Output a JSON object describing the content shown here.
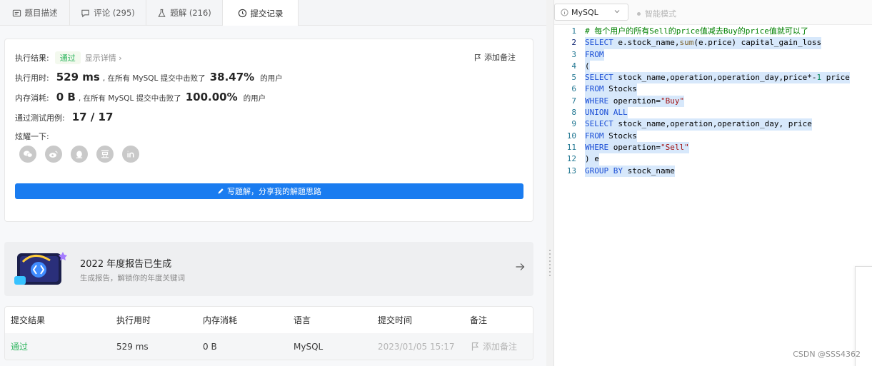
{
  "tabs": [
    {
      "label": "题目描述",
      "icon": "description-icon"
    },
    {
      "label": "评论 (295)",
      "icon": "comment-icon"
    },
    {
      "label": "题解 (216)",
      "icon": "flask-icon"
    },
    {
      "label": "提交记录",
      "icon": "clock-icon"
    }
  ],
  "result": {
    "label": "执行结果:",
    "status": "通过",
    "detail_link": "显示详情 ›",
    "add_note": "添加备注",
    "runtime_label": "执行用时:",
    "runtime_value": "529 ms",
    "runtime_text": ", 在所有 MySQL 提交中击败了",
    "runtime_percent": "38.47%",
    "runtime_suffix": "的用户",
    "memory_label": "内存消耗:",
    "memory_value": "0 B",
    "memory_text": ", 在所有 MySQL 提交中击败了",
    "memory_percent": "100.00%",
    "memory_suffix": "的用户",
    "tests_label": "通过测试用例:",
    "tests_value": "17  /  17",
    "share_label": "炫耀一下:",
    "share_icons": [
      "wechat-icon",
      "weibo-icon",
      "qq-icon",
      "douban-icon",
      "linkedin-icon"
    ],
    "write_button": "写题解，分享我的解题思路"
  },
  "banner": {
    "title": "2022 年度报告已生成",
    "subtitle": "生成报告，解锁你的年度关键词"
  },
  "table": {
    "headers": [
      "提交结果",
      "执行用时",
      "内存消耗",
      "语言",
      "提交时间",
      "备注"
    ],
    "row": {
      "result": "通过",
      "runtime": "529 ms",
      "memory": "0 B",
      "language": "MySQL",
      "time": "2023/01/05 15:17",
      "note": "添加备注"
    }
  },
  "editor": {
    "language": "MySQL",
    "smart_mode": "智能模式",
    "line_numbers": [
      "1",
      "2",
      "3",
      "4",
      "5",
      "6",
      "7",
      "8",
      "9",
      "10",
      "11",
      "12",
      "13"
    ],
    "code_lines": [
      [
        {
          "t": "# 每个用户的所有Sell的price值减去Buy的price值就可以了",
          "c": "cmt"
        }
      ],
      [
        {
          "t": "SELECT",
          "c": "kw"
        },
        {
          "t": " e.stock_name,",
          "c": "plain"
        },
        {
          "t": "sum",
          "c": "fn"
        },
        {
          "t": "(e.price) capital_gain_loss",
          "c": "plain"
        }
      ],
      [
        {
          "t": "FROM",
          "c": "kw"
        }
      ],
      [
        {
          "t": "(",
          "c": "plain"
        }
      ],
      [
        {
          "t": "SELECT",
          "c": "kw"
        },
        {
          "t": " stock_name,operation,operation_day,price*-",
          "c": "plain"
        },
        {
          "t": "1",
          "c": "num"
        },
        {
          "t": " price",
          "c": "plain"
        }
      ],
      [
        {
          "t": "FROM",
          "c": "kw"
        },
        {
          "t": " Stocks",
          "c": "plain"
        }
      ],
      [
        {
          "t": "WHERE",
          "c": "kw"
        },
        {
          "t": " operation=",
          "c": "plain"
        },
        {
          "t": "\"Buy\"",
          "c": "str"
        }
      ],
      [
        {
          "t": "UNION ALL",
          "c": "kw"
        }
      ],
      [
        {
          "t": "SELECT",
          "c": "kw"
        },
        {
          "t": " stock_name,operation,operation_day, price",
          "c": "plain"
        }
      ],
      [
        {
          "t": "FROM",
          "c": "kw"
        },
        {
          "t": " Stocks",
          "c": "plain"
        }
      ],
      [
        {
          "t": "WHERE",
          "c": "kw"
        },
        {
          "t": " operation=",
          "c": "plain"
        },
        {
          "t": "\"Sell\"",
          "c": "str"
        }
      ],
      [
        {
          "t": ") e",
          "c": "plain"
        }
      ],
      [
        {
          "t": "GROUP BY",
          "c": "kw"
        },
        {
          "t": " stock_name",
          "c": "plain"
        }
      ]
    ]
  },
  "watermark": "CSDN @SSS4362",
  "colors": {
    "accent": "#1a7cf0",
    "success": "#2db55d"
  }
}
